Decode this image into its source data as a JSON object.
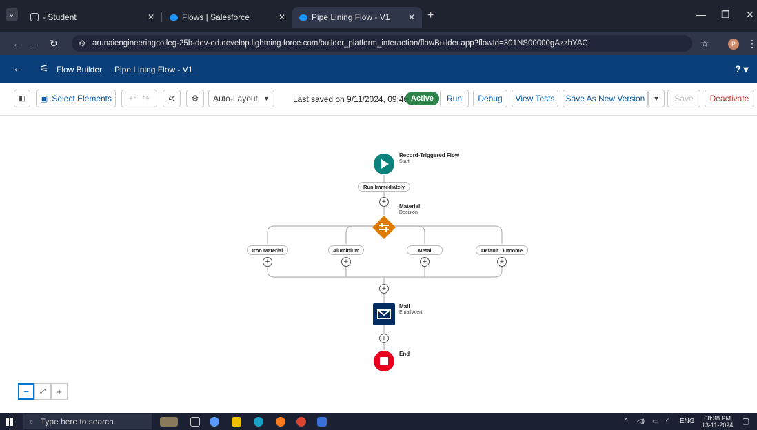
{
  "browser": {
    "tabs": [
      {
        "title": "- Student"
      },
      {
        "title": "Flows | Salesforce"
      },
      {
        "title": "Pipe Lining Flow - V1"
      }
    ],
    "url": "arunaiengineeringcolleg-25b-dev-ed.develop.lightning.force.com/builder_platform_interaction/flowBuilder.app?flowId=301NS00000gAzzhYAC",
    "profile_initial": "P"
  },
  "header": {
    "app_name": "Flow Builder",
    "flow_name": "Pipe Lining Flow - V1",
    "help": "?"
  },
  "toolbar": {
    "select_elements": "Select Elements",
    "layout_mode": "Auto-Layout",
    "last_saved": "Last saved on 9/11/2024, 09:40 pm",
    "status": "Active",
    "run": "Run",
    "debug": "Debug",
    "view_tests": "View Tests",
    "save_as_new_version": "Save As New Version",
    "save": "Save",
    "deactivate": "Deactivate"
  },
  "flow": {
    "start": {
      "title": "Record-Triggered Flow",
      "subtitle": "Start"
    },
    "run_immediately": "Run Immediately",
    "decision": {
      "title": "Material",
      "subtitle": "Decision"
    },
    "outcomes": [
      "Iron Material",
      "Aluminium",
      "Metal",
      "Default Outcome"
    ],
    "action": {
      "title": "Mail",
      "subtitle": "Email Alert"
    },
    "end": {
      "title": "End"
    }
  },
  "taskbar": {
    "search_placeholder": "Type here to search",
    "language": "ENG",
    "time": "08:38 PM",
    "date": "13-11-2024"
  },
  "colors": {
    "start_node": "#0b827c",
    "decision_node": "#dd7a01",
    "action_node": "#032d60",
    "end_node": "#ea001e",
    "active_badge": "#2e844a",
    "header_bg": "#0b3f79"
  }
}
